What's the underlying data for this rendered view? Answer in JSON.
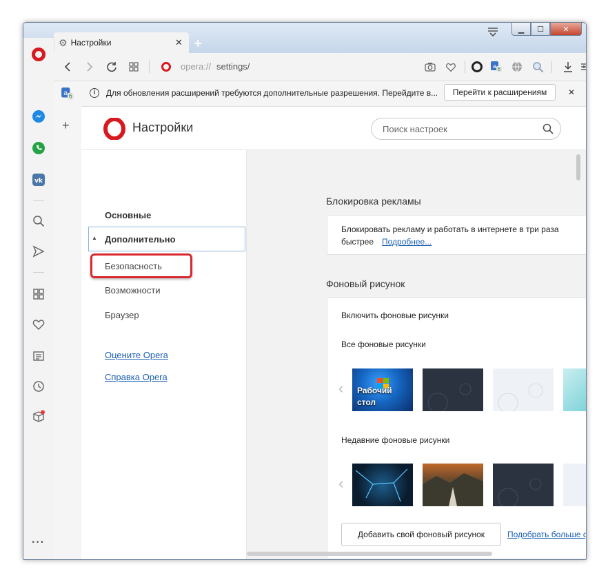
{
  "window": {
    "minimize": "▁",
    "maximize": "☐",
    "close": "✕"
  },
  "tab": {
    "title": "Настройки",
    "close": "✕",
    "new_tab": "+"
  },
  "address_bar": {
    "url_prefix": "opera://",
    "url_path": "settings/"
  },
  "sidebar": {
    "more": "···"
  },
  "notice": {
    "info": "i",
    "text": "Для обновления расширений требуются дополнительные разрешения. Перейдите в...",
    "button": "Перейти к расширениям",
    "close": "✕"
  },
  "settings": {
    "title": "Настройки",
    "search_placeholder": "Поиск настроек"
  },
  "nav": {
    "basic": "Основные",
    "advanced": "Дополнительно",
    "security": "Безопасность",
    "features": "Возможности",
    "browser": "Браузер",
    "rate": "Оцените Opera",
    "help": "Справка Opera"
  },
  "adblock": {
    "heading": "Блокировка рекламы",
    "text_line1": "Блокировать рекламу и работать в интернете в три раза",
    "text_line2": "быстрее",
    "more_link": "Подробнее..."
  },
  "wallpaper": {
    "heading": "Фоновый рисунок",
    "enable": "Включить фоновые рисунки",
    "all": "Все фоновые рисунки",
    "desktop_label_1": "Рабочий",
    "desktop_label_2": "стол",
    "recent": "Недавние фоновые рисунки",
    "add_button": "Добавить свой фоновый рисунок",
    "more_link": "Подобрать больше ф",
    "prev": "‹"
  },
  "colors": {
    "opera_red": "#d71920",
    "highlight_red": "#d9282f",
    "link_blue": "#1a5fb4"
  }
}
